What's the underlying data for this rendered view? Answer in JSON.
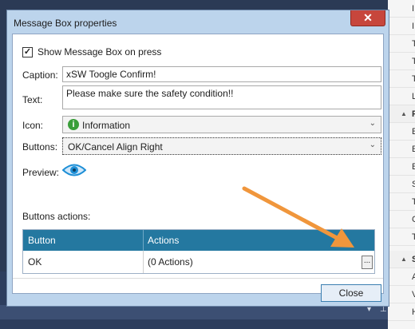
{
  "dialog": {
    "title": "Message Box properties",
    "close_glyph": "✕",
    "show_checkbox": {
      "label": "Show Message Box on press",
      "checked": true,
      "mark": "✓"
    },
    "caption": {
      "label": "Caption:",
      "value": "xSW Toogle Confirm!"
    },
    "text": {
      "label": "Text:",
      "value": "Please make sure the safety condition!!"
    },
    "icon": {
      "label": "Icon:",
      "value": "Information",
      "icon_glyph": "i",
      "icon_name": "information-icon",
      "chevron": "⌄"
    },
    "buttons": {
      "label": "Buttons:",
      "value": "OK/Cancel Align Right",
      "chevron": "⌄"
    },
    "preview": {
      "label": "Preview:",
      "icon_name": "eye-icon"
    },
    "actions": {
      "label": "Buttons actions:",
      "columns": [
        "Button",
        "Actions"
      ],
      "rows": [
        {
          "button": "OK",
          "actions": "(0 Actions)",
          "edit_glyph": "..."
        }
      ]
    },
    "close_button": "Close"
  },
  "background": {
    "side_rows": [
      "I",
      "I",
      "T",
      "T",
      "T",
      "L",
      "P",
      "E",
      "E",
      "E",
      "S",
      "T",
      "C",
      "T",
      "S",
      "A",
      "V",
      "H"
    ],
    "section_glyph": "▲",
    "dock_glyphs": [
      "▾",
      "⊥"
    ]
  },
  "colors": {
    "accent": "#2478a0",
    "close_red": "#c7463c",
    "arrow": "#f0963c",
    "info_green": "#3a9e3a",
    "eye_blue": "#1e8fd6"
  }
}
